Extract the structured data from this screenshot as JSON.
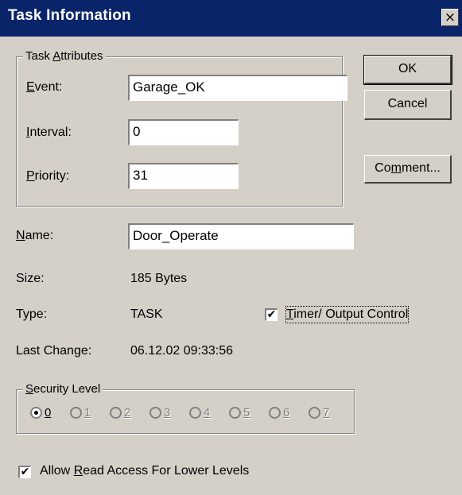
{
  "window": {
    "title": "Task Information",
    "close_glyph": "×"
  },
  "task_attributes": {
    "legend_pre": "Task ",
    "legend_key": "A",
    "legend_post": "ttributes",
    "event_key": "E",
    "event_rest": "vent:",
    "event_value": "Garage_OK",
    "interval_key": "I",
    "interval_rest": "nterval:",
    "interval_value": "0",
    "priority_key": "P",
    "priority_rest": "riority:",
    "priority_value": "31"
  },
  "buttons": {
    "ok": "OK",
    "cancel": "Cancel",
    "comment_pre": "Co",
    "comment_key": "m",
    "comment_post": "ment..."
  },
  "name": {
    "key": "N",
    "rest": "ame:",
    "value": "Door_Operate"
  },
  "size": {
    "label": "Size:",
    "value": "185 Bytes"
  },
  "type": {
    "label": "Type:",
    "value": "TASK"
  },
  "timer_output": {
    "checked": true,
    "check_glyph": "✔",
    "label_key": "T",
    "label_rest": "imer/ Output Control"
  },
  "last_change": {
    "label": "Last Change:",
    "value": "06.12.02 09:33:56"
  },
  "security_level": {
    "legend_key": "S",
    "legend_rest": "ecurity Level",
    "selected": "0",
    "levels": [
      "0",
      "1",
      "2",
      "3",
      "4",
      "5",
      "6",
      "7"
    ]
  },
  "read_access": {
    "checked": true,
    "check_glyph": "✔",
    "pre": "Allow ",
    "key": "R",
    "post": "ead Access For Lower Levels"
  }
}
